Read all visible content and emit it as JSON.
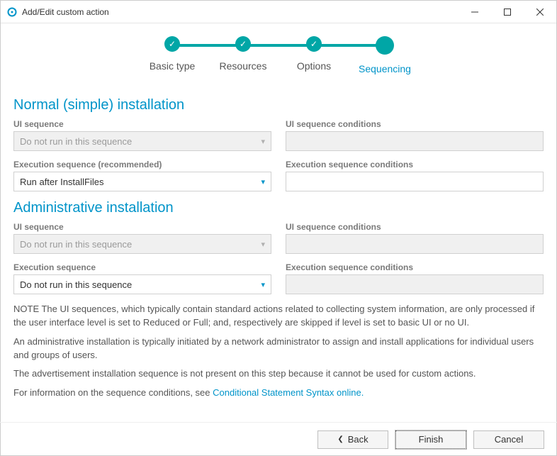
{
  "window": {
    "title": "Add/Edit custom action"
  },
  "stepper": {
    "steps": [
      {
        "label": "Basic type",
        "done": true
      },
      {
        "label": "Resources",
        "done": true
      },
      {
        "label": "Options",
        "done": true
      },
      {
        "label": "Sequencing",
        "active": true
      }
    ]
  },
  "sections": {
    "normal": {
      "heading": "Normal (simple) installation",
      "ui_seq_label": "UI sequence",
      "ui_seq_value": "Do not run in this sequence",
      "ui_cond_label": "UI sequence conditions",
      "ui_cond_value": "",
      "exec_seq_label": "Execution sequence (recommended)",
      "exec_seq_value": "Run after InstallFiles",
      "exec_cond_label": "Execution sequence conditions",
      "exec_cond_value": ""
    },
    "admin": {
      "heading": "Administrative installation",
      "ui_seq_label": "UI sequence",
      "ui_seq_value": "Do not run in this sequence",
      "ui_cond_label": "UI sequence conditions",
      "ui_cond_value": "",
      "exec_seq_label": "Execution sequence",
      "exec_seq_value": "Do not run in this sequence",
      "exec_cond_label": "Execution sequence conditions",
      "exec_cond_value": ""
    }
  },
  "notes": {
    "n1": "NOTE The UI sequences, which typically contain standard actions related to collecting system information, are only processed if the user interface level is set to Reduced or Full; and, respectively are skipped if level is set to basic UI or no UI.",
    "n2": "An administrative installation is typically initiated by a network administrator to assign and install applications for individual users and groups of users.",
    "n3": "The advertisement installation sequence is not present on this step because it cannot be used for custom actions.",
    "n4_prefix": "For information on the sequence conditions, see ",
    "n4_link": "Conditional Statement Syntax online."
  },
  "footer": {
    "back": "Back",
    "finish": "Finish",
    "cancel": "Cancel"
  }
}
